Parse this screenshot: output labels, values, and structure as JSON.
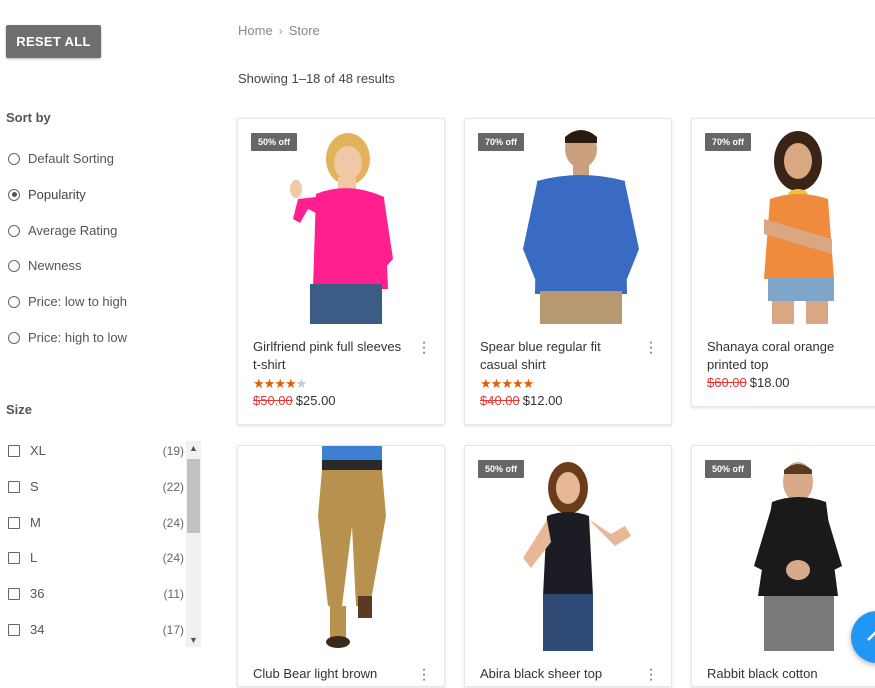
{
  "filters": {
    "reset_label": "RESET ALL",
    "sort_title": "Sort by",
    "sort_options": [
      {
        "label": "Default Sorting",
        "selected": false
      },
      {
        "label": "Popularity",
        "selected": true
      },
      {
        "label": "Average Rating",
        "selected": false
      },
      {
        "label": "Newness",
        "selected": false
      },
      {
        "label": "Price: low to high",
        "selected": false
      },
      {
        "label": "Price: high to low",
        "selected": false
      }
    ],
    "size_title": "Size",
    "sizes": [
      {
        "label": "XL",
        "count": "(19)"
      },
      {
        "label": "S",
        "count": "(22)"
      },
      {
        "label": "M",
        "count": "(24)"
      },
      {
        "label": "L",
        "count": "(24)"
      },
      {
        "label": "36",
        "count": "(11)"
      },
      {
        "label": "34",
        "count": "(17)"
      }
    ]
  },
  "breadcrumb": {
    "home": "Home",
    "current": "Store"
  },
  "results_text": "Showing 1–18 of 48 results",
  "products": [
    {
      "badge": "50% off",
      "name": "Girlfriend pink full sleeves t-shirt",
      "rating": 4,
      "old_price": "$50.00",
      "price": "$25.00"
    },
    {
      "badge": "70% off",
      "name": "Spear blue regular fit casual shirt",
      "rating": 5,
      "old_price": "$40.00",
      "price": "$12.00"
    },
    {
      "badge": "70% off",
      "name": "Shanaya coral orange printed top",
      "old_price": "$60.00",
      "price": "$18.00"
    },
    {
      "name": "Club Bear light brown"
    },
    {
      "badge": "50% off",
      "name": "Abira black sheer top"
    },
    {
      "badge": "50% off",
      "name": "Rabbit black cotton"
    }
  ],
  "colors": {
    "accent": "#2196f3",
    "sale": "#e53935",
    "star": "#e65c00",
    "badge": "#666666"
  }
}
